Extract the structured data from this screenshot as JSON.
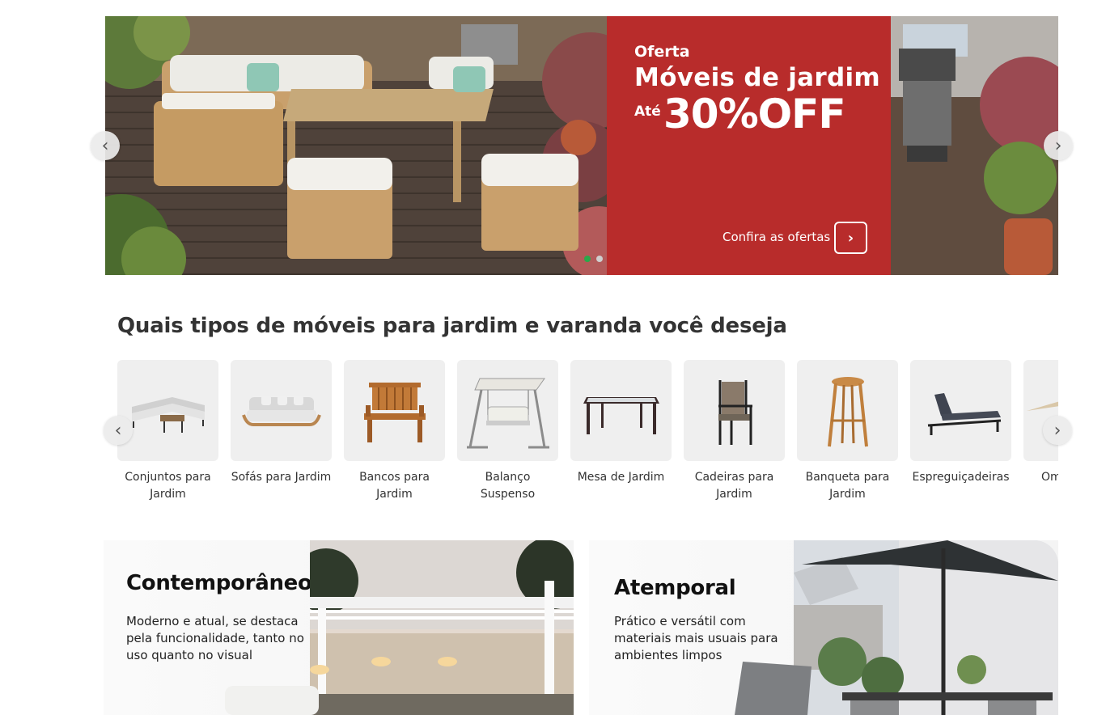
{
  "hero": {
    "kicker": "Oferta",
    "title": "Móveis de jardim",
    "upto": "Até",
    "discount": "30%OFF",
    "cta_label": "Confira as ofertas",
    "cta_icon": "chevron-right-icon",
    "promo_color": "#b82c2b",
    "slides_total": 2,
    "active_slide": 1,
    "prev_icon": "chevron-left-icon",
    "next_icon": "chevron-right-icon"
  },
  "categories": {
    "title": "Quais tipos de móveis para jardim e varanda você deseja",
    "items": [
      {
        "label": "Conjuntos para Jardim",
        "icon": "sectional-sofa-set-icon"
      },
      {
        "label": "Sofás para Jardim",
        "icon": "garden-sofa-icon"
      },
      {
        "label": "Bancos para Jardim",
        "icon": "wooden-bench-icon"
      },
      {
        "label": "Balanço Suspenso",
        "icon": "swing-chair-icon"
      },
      {
        "label": "Mesa de Jardim",
        "icon": "garden-table-icon"
      },
      {
        "label": "Cadeiras para Jardim",
        "icon": "garden-chair-icon"
      },
      {
        "label": "Banqueta para Jardim",
        "icon": "bar-stool-icon"
      },
      {
        "label": "Espreguiçadeiras",
        "icon": "sun-lounger-icon"
      },
      {
        "label": "Om",
        "icon": "umbrella-icon"
      }
    ]
  },
  "styles": [
    {
      "title": "Contemporâneo",
      "text": "Moderno e atual, se destaca pela funcionalidade, tanto no uso quanto no visual"
    },
    {
      "title": "Atemporal",
      "text": "Prático e versátil com materiais mais usuais para ambientes limpos"
    }
  ]
}
